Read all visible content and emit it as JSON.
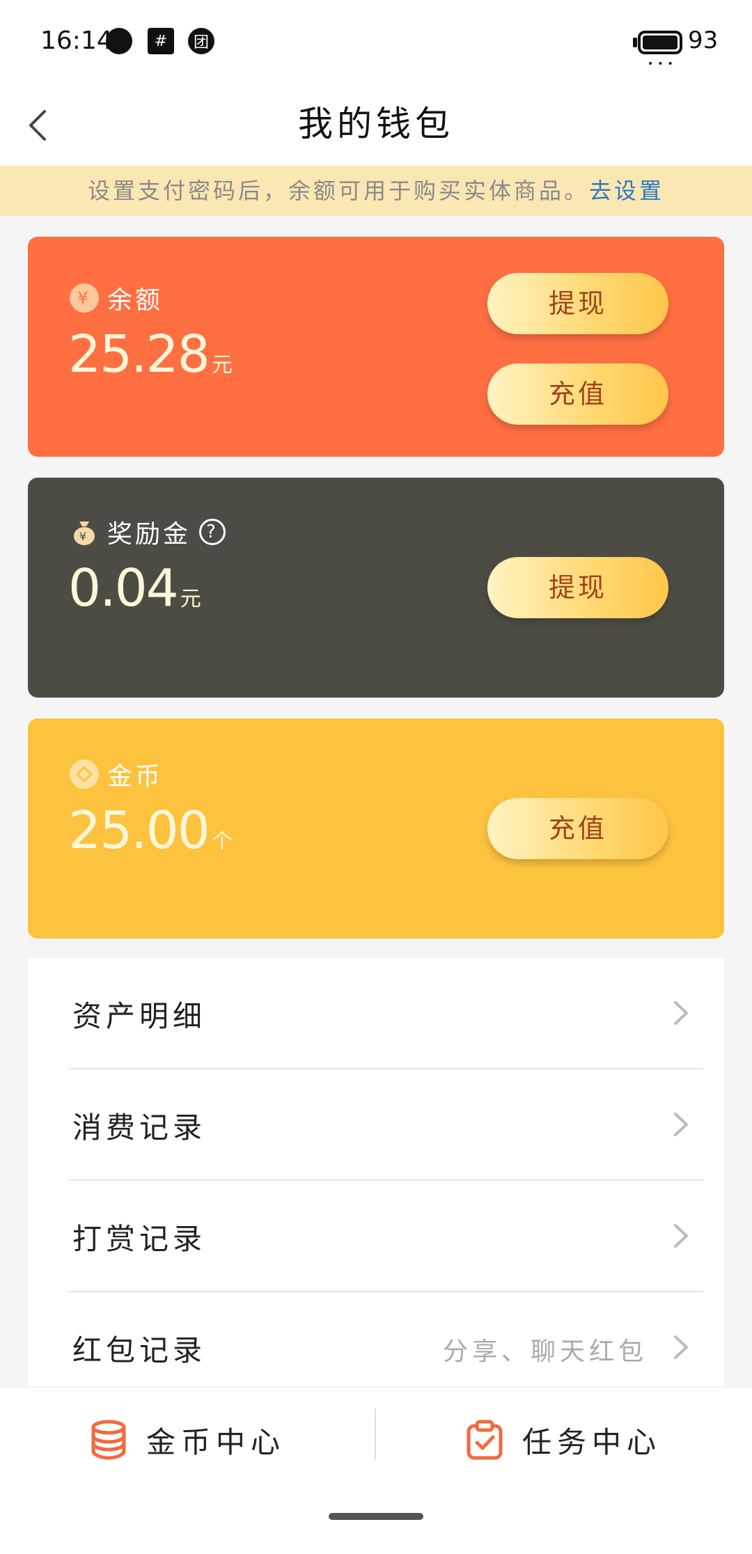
{
  "status_bar": {
    "time": "16:14",
    "battery": "93"
  },
  "header": {
    "title": "我的钱包"
  },
  "notice": {
    "text": "设置支付密码后，余额可用于购买实体商品。",
    "link": "去设置"
  },
  "balance_card": {
    "label": "余额",
    "amount": "25.28",
    "unit": "元",
    "withdraw_label": "提现",
    "recharge_label": "充值",
    "color": "#ff6f42"
  },
  "reward_card": {
    "label": "奖励金",
    "amount": "0.04",
    "unit": "元",
    "withdraw_label": "提现",
    "color": "#4d4c44"
  },
  "coin_card": {
    "label": "金币",
    "amount": "25.00",
    "unit": "个",
    "recharge_label": "充值",
    "color": "#fdc23e"
  },
  "menu": [
    {
      "label": "资产明细",
      "hint": ""
    },
    {
      "label": "消费记录",
      "hint": ""
    },
    {
      "label": "打赏记录",
      "hint": ""
    },
    {
      "label": "红包记录",
      "hint": "分享、聊天红包"
    }
  ],
  "bottom_tabs": {
    "coin_center": "金币中心",
    "task_center": "任务中心"
  },
  "accent_color": "#f26a3d"
}
